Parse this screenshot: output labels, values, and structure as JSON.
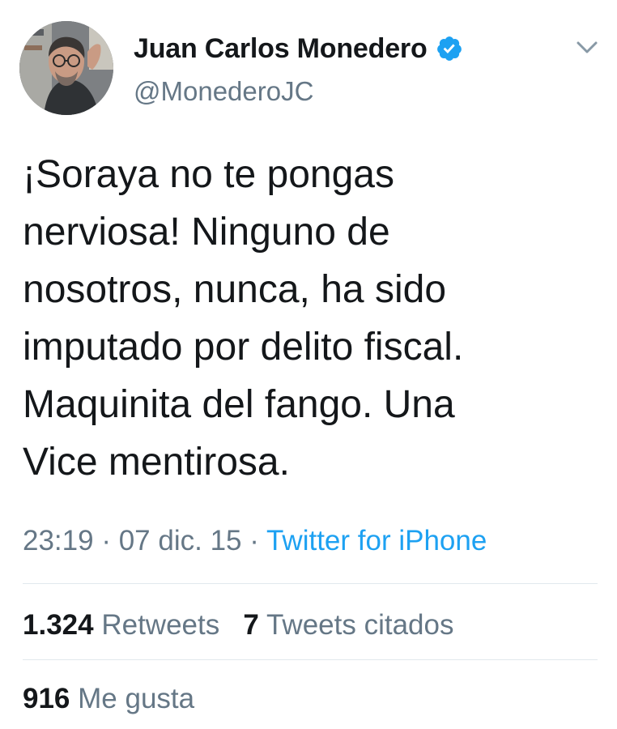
{
  "author": {
    "display_name": "Juan Carlos Monedero",
    "handle": "@MonederoJC",
    "verified": true
  },
  "icons": {
    "verified": "verified-badge-icon",
    "menu": "chevron-down-icon"
  },
  "tweet": {
    "lines": [
      "¡Soraya no te pongas",
      "nerviosa! Ninguno de",
      "nosotros, nunca, ha sido",
      "imputado por delito fiscal.",
      "Maquinita del fango. Una",
      "Vice mentirosa."
    ],
    "time": "23:19",
    "date": "07 dic. 15",
    "separator": "·",
    "source": "Twitter for iPhone"
  },
  "stats": {
    "retweets_count": "1.324",
    "retweets_label": "Retweets",
    "quotes_count": "7",
    "quotes_label": "Tweets citados",
    "likes_count": "916",
    "likes_label": "Me gusta"
  },
  "colors": {
    "text": "#14171a",
    "muted": "#657786",
    "link": "#1da1f2",
    "divider": "#e1e8ed"
  }
}
